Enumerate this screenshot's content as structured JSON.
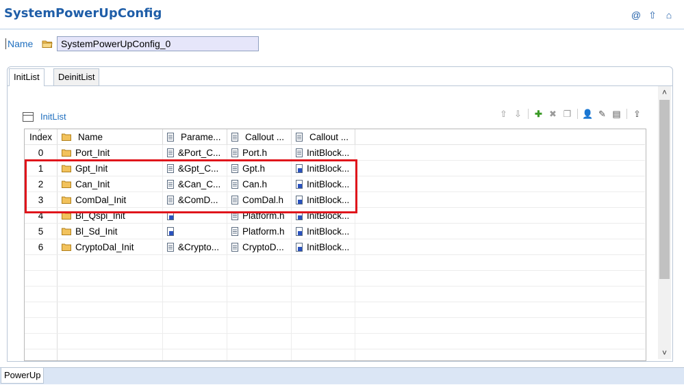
{
  "title": "SystemPowerUpConfig",
  "top_icons": [
    "at-icon",
    "arrow-up-icon",
    "home-icon"
  ],
  "name_field": {
    "label": "Name",
    "value": "SystemPowerUpConfig_0"
  },
  "tabs": [
    {
      "label": "InitList"
    },
    {
      "label": "DeinitList"
    }
  ],
  "inner_title": "InitList",
  "toolbar_icons": [
    "move-up-icon",
    "move-down-icon",
    "add-icon",
    "delete-icon",
    "copy-icon",
    "user-icon",
    "edit-icon",
    "properties-icon",
    "export-icon"
  ],
  "table": {
    "columns": [
      "Index",
      "Name",
      "Parame...",
      "Callout ...",
      "Callout ..."
    ],
    "rows": [
      {
        "index": "0",
        "name": "Port_Init",
        "param": "&Port_C...",
        "callout_file": "Port.h",
        "callout_fn": "InitBlock..."
      },
      {
        "index": "1",
        "name": "Gpt_Init",
        "param": "&Gpt_C...",
        "callout_file": "Gpt.h",
        "callout_fn": "InitBlock..."
      },
      {
        "index": "2",
        "name": "Can_Init",
        "param": "&Can_C...",
        "callout_file": "Can.h",
        "callout_fn": "InitBlock..."
      },
      {
        "index": "3",
        "name": "ComDal_Init",
        "param": "&ComD...",
        "callout_file": "ComDal.h",
        "callout_fn": "InitBlock..."
      },
      {
        "index": "4",
        "name": "Bl_Qspi_Init",
        "param": "",
        "callout_file": "Platform.h",
        "callout_fn": "InitBlock..."
      },
      {
        "index": "5",
        "name": "Bl_Sd_Init",
        "param": "",
        "callout_file": "Platform.h",
        "callout_fn": "InitBlock..."
      },
      {
        "index": "6",
        "name": "CryptoDal_Init",
        "param": "&Crypto...",
        "callout_file": "CryptoD...",
        "callout_fn": "InitBlock..."
      }
    ],
    "empty_rows": 7
  },
  "bottom_tab": "PowerUp",
  "colors": {
    "title": "#1f5ea8",
    "link": "#1f6fbf",
    "highlight": "#e0141b",
    "input_bg": "#e6e6fa"
  }
}
